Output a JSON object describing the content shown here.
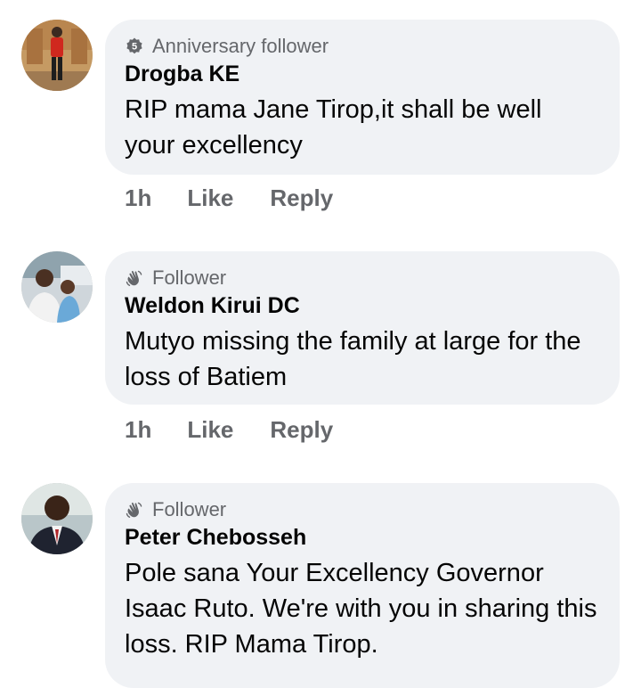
{
  "comments": [
    {
      "badge_icon": "anniversary-5-icon",
      "badge": "Anniversary follower",
      "author": "Drogba KE",
      "text": "RIP mama Jane Tirop,it shall be well your excellency",
      "time": "1h",
      "like_label": "Like",
      "reply_label": "Reply"
    },
    {
      "badge_icon": "wave-hand-icon",
      "badge": "Follower",
      "author": "Weldon Kirui DC",
      "text": "Mutyo missing the family at large for the loss of Batiem",
      "time": "1h",
      "like_label": "Like",
      "reply_label": "Reply"
    },
    {
      "badge_icon": "wave-hand-icon",
      "badge": "Follower",
      "author": "Peter Chebosseh",
      "text": "Pole sana Your Excellency Governor Isaac Ruto.  We're with you in sharing this loss. RIP Mama Tirop."
    }
  ],
  "colors": {
    "bubble": "#f0f2f5",
    "secondary_text": "#65676b",
    "primary_text": "#050505"
  }
}
